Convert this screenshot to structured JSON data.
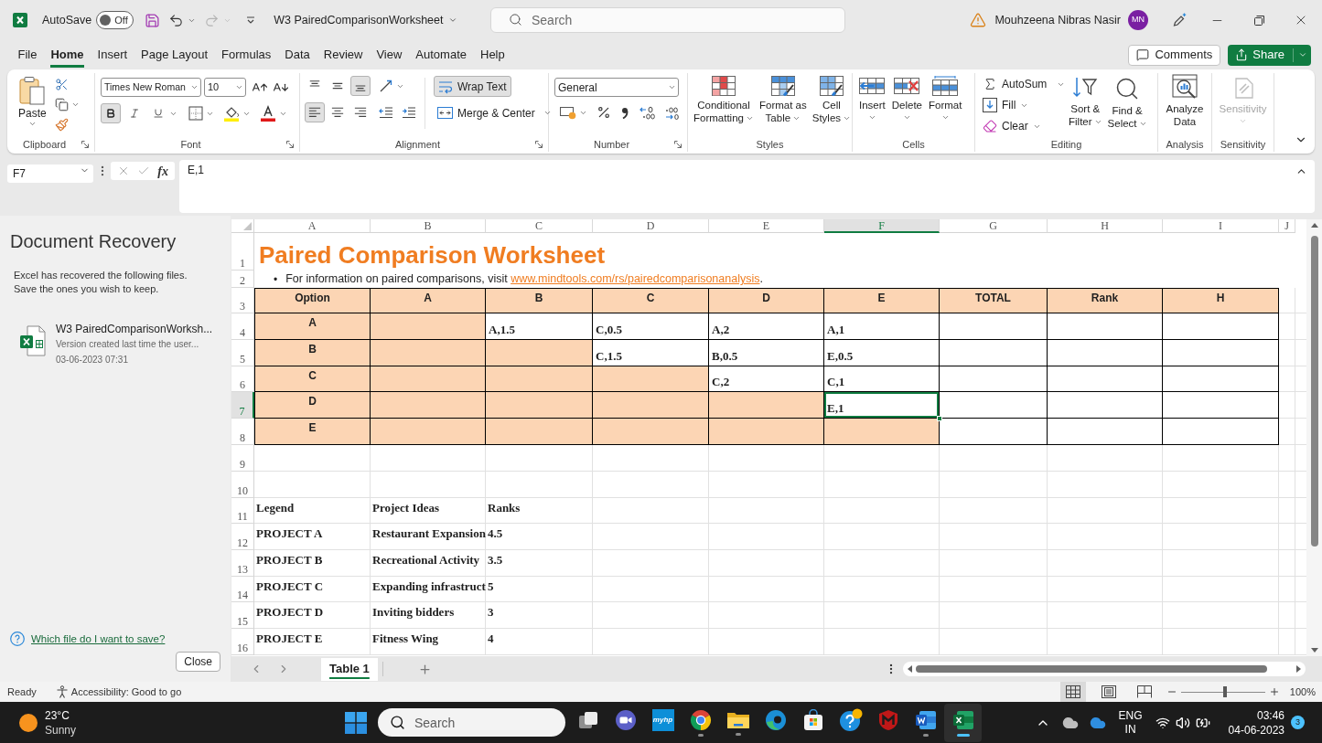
{
  "title_bar": {
    "autosave_label": "AutoSave",
    "autosave": {
      "on": false,
      "label": "Off"
    },
    "redo": {
      "disabled": true
    },
    "document_title": "W3 PairedComparisonWorksheet",
    "search_placeholder": "Search",
    "user_name": "Mouhzeena Nibras Nasir",
    "user_initials": "MN"
  },
  "menu_tabs": [
    {
      "label": "File",
      "selected": false
    },
    {
      "label": "Home",
      "selected": true
    },
    {
      "label": "Insert",
      "selected": false
    },
    {
      "label": "Page Layout",
      "selected": false
    },
    {
      "label": "Formulas",
      "selected": false
    },
    {
      "label": "Data",
      "selected": false
    },
    {
      "label": "Review",
      "selected": false
    },
    {
      "label": "View",
      "selected": false
    },
    {
      "label": "Automate",
      "selected": false
    },
    {
      "label": "Help",
      "selected": false
    }
  ],
  "comments_button": "Comments",
  "share_button": "Share",
  "ribbon": {
    "clipboard": {
      "paste": "Paste",
      "label": "Clipboard"
    },
    "font": {
      "font_name": "Times New Roman",
      "font_size": "10",
      "bold": true,
      "italic": false,
      "underline": false,
      "label": "Font"
    },
    "alignment": {
      "vertical": [
        {
          "kind": "top",
          "selected": false
        },
        {
          "kind": "middle",
          "selected": false
        },
        {
          "kind": "bottom",
          "selected": true
        }
      ],
      "horizontal": [
        {
          "kind": "left",
          "selected": true
        },
        {
          "kind": "center",
          "selected": false
        },
        {
          "kind": "right",
          "selected": false
        }
      ],
      "wrap_text": {
        "label": "Wrap Text",
        "on": true
      },
      "merge": "Merge & Center",
      "label": "Alignment"
    },
    "number": {
      "format": "General",
      "label": "Number"
    },
    "styles": {
      "buttons": [
        {
          "kind": "conditional_formatting",
          "lines": [
            "Conditional",
            "Formatting"
          ]
        },
        {
          "kind": "format_as_table",
          "lines": [
            "Format as",
            "Table"
          ]
        },
        {
          "kind": "cell_styles",
          "lines": [
            "Cell",
            "Styles"
          ]
        }
      ],
      "label": "Styles"
    },
    "cells": {
      "buttons": [
        {
          "kind": "insert",
          "label": "Insert"
        },
        {
          "kind": "delete",
          "label": "Delete"
        },
        {
          "kind": "format",
          "label": "Format"
        }
      ],
      "label": "Cells"
    },
    "editing": {
      "autosum": "AutoSum",
      "fill": "Fill",
      "clear": "Clear",
      "buttons": [
        {
          "kind": "sort_filter",
          "lines": [
            "Sort &",
            "Filter"
          ]
        },
        {
          "kind": "find_select",
          "lines": [
            "Find &",
            "Select"
          ]
        }
      ],
      "label": "Editing"
    },
    "analysis": {
      "lines": [
        "Analyze",
        "Data"
      ],
      "label": "Analysis"
    },
    "sensitivity": {
      "button": "Sensitivity",
      "disabled": true,
      "label": "Sensitivity"
    }
  },
  "formula_bar": {
    "name_box": "F7",
    "function_label": "fx",
    "formula": "E,1"
  },
  "document_recovery": {
    "title": "Document Recovery",
    "message_lines": [
      "Excel has recovered the following files.",
      "Save the ones you wish to keep."
    ],
    "files": [
      {
        "name": "W3 PairedComparisonWorksh...",
        "description": "Version created last time the user...",
        "date": "03-06-2023 07:31"
      }
    ],
    "help_link": "Which file do I want to save?",
    "close_button": "Close"
  },
  "sheet": {
    "column_headers": [
      {
        "label": "A",
        "selected": false
      },
      {
        "label": "B",
        "selected": false
      },
      {
        "label": "C",
        "selected": false
      },
      {
        "label": "D",
        "selected": false
      },
      {
        "label": "E",
        "selected": false
      },
      {
        "label": "F",
        "selected": true
      },
      {
        "label": "G",
        "selected": false
      },
      {
        "label": "H",
        "selected": false
      },
      {
        "label": "I",
        "selected": false
      },
      {
        "label": "J",
        "selected": false
      }
    ],
    "row_headers": [
      {
        "label": "1",
        "selected": false
      },
      {
        "label": "2",
        "selected": false
      },
      {
        "label": "3",
        "selected": false
      },
      {
        "label": "4",
        "selected": false
      },
      {
        "label": "5",
        "selected": false
      },
      {
        "label": "6",
        "selected": false
      },
      {
        "label": "7",
        "selected": true
      },
      {
        "label": "8",
        "selected": false
      },
      {
        "label": "9",
        "selected": false
      },
      {
        "label": "10",
        "selected": false
      },
      {
        "label": "11",
        "selected": false
      },
      {
        "label": "12",
        "selected": false
      },
      {
        "label": "13",
        "selected": false
      },
      {
        "label": "14",
        "selected": false
      },
      {
        "label": "15",
        "selected": false
      },
      {
        "label": "16",
        "selected": false
      }
    ],
    "title": "Paired Comparison Worksheet",
    "note": {
      "bullet": "•",
      "text": "For information on paired comparisons, visit",
      "link": "www.mindtools.com/rs/pairedcomparisonanalysis",
      "end": "."
    },
    "comparison_table": {
      "rows": [
        {
          "cells": [
            {
              "text": "Option",
              "shaded": true,
              "selected": false
            },
            {
              "text": "A",
              "shaded": true,
              "selected": false
            },
            {
              "text": "B",
              "shaded": true,
              "selected": false
            },
            {
              "text": "C",
              "shaded": true,
              "selected": false
            },
            {
              "text": "D",
              "shaded": true,
              "selected": false
            },
            {
              "text": "E",
              "shaded": true,
              "selected": false
            },
            {
              "text": "TOTAL",
              "shaded": true,
              "selected": false
            },
            {
              "text": "Rank",
              "shaded": true,
              "selected": false
            },
            {
              "text": "H",
              "shaded": true,
              "selected": false
            }
          ]
        },
        {
          "cells": [
            {
              "text": "A",
              "shaded": true,
              "selected": false
            },
            {
              "shaded": true,
              "selected": false
            },
            {
              "text": "A,1.5",
              "shaded": false,
              "selected": false
            },
            {
              "text": "C,0.5",
              "shaded": false,
              "selected": false
            },
            {
              "text": "A,2",
              "shaded": false,
              "selected": false
            },
            {
              "text": "A,1",
              "shaded": false,
              "selected": false
            },
            {
              "shaded": false,
              "selected": false
            },
            {
              "shaded": false,
              "selected": false
            },
            {
              "shaded": false,
              "selected": false
            }
          ]
        },
        {
          "cells": [
            {
              "text": "B",
              "shaded": true,
              "selected": false
            },
            {
              "shaded": true,
              "selected": false
            },
            {
              "shaded": true,
              "selected": false
            },
            {
              "text": "C,1.5",
              "shaded": false,
              "selected": false
            },
            {
              "text": "B,0.5",
              "shaded": false,
              "selected": false
            },
            {
              "text": "E,0.5",
              "shaded": false,
              "selected": false
            },
            {
              "shaded": false,
              "selected": false
            },
            {
              "shaded": false,
              "selected": false
            },
            {
              "shaded": false,
              "selected": false
            }
          ]
        },
        {
          "cells": [
            {
              "text": "C",
              "shaded": true,
              "selected": false
            },
            {
              "shaded": true,
              "selected": false
            },
            {
              "shaded": true,
              "selected": false
            },
            {
              "shaded": true,
              "selected": false
            },
            {
              "text": "C,2",
              "shaded": false,
              "selected": false
            },
            {
              "text": "C,1",
              "shaded": false,
              "selected": false
            },
            {
              "shaded": false,
              "selected": false
            },
            {
              "shaded": false,
              "selected": false
            },
            {
              "shaded": false,
              "selected": false
            }
          ]
        },
        {
          "cells": [
            {
              "text": "D",
              "shaded": true,
              "selected": false
            },
            {
              "shaded": true,
              "selected": false
            },
            {
              "shaded": true,
              "selected": false
            },
            {
              "shaded": true,
              "selected": false
            },
            {
              "shaded": true,
              "selected": false
            },
            {
              "text": "E,1",
              "shaded": false,
              "selected": true
            },
            {
              "shaded": false,
              "selected": false
            },
            {
              "shaded": false,
              "selected": false
            },
            {
              "shaded": false,
              "selected": false
            }
          ]
        },
        {
          "cells": [
            {
              "text": "E",
              "shaded": true,
              "selected": false
            },
            {
              "shaded": true,
              "selected": false
            },
            {
              "shaded": true,
              "selected": false
            },
            {
              "shaded": true,
              "selected": false
            },
            {
              "shaded": true,
              "selected": false
            },
            {
              "shaded": true,
              "selected": false
            },
            {
              "shaded": false,
              "selected": false
            },
            {
              "shaded": false,
              "selected": false
            },
            {
              "shaded": false,
              "selected": false
            }
          ]
        }
      ]
    },
    "legend_table": {
      "rows": [
        [
          "Legend",
          "Project Ideas",
          "Ranks"
        ],
        [
          "PROJECT A",
          "Restaurant Expansion",
          "4.5"
        ],
        [
          "PROJECT B",
          "Recreational Activity",
          "3.5"
        ],
        [
          "PROJECT C",
          "Expanding infrastruct",
          "5"
        ],
        [
          "PROJECT D",
          "Inviting bidders",
          "3"
        ],
        [
          "PROJECT E",
          "Fitness Wing",
          "4"
        ]
      ]
    }
  },
  "sheet_tabs": [
    {
      "label": "Table 1",
      "selected": true
    }
  ],
  "status_bar": {
    "status": "Ready",
    "accessibility": "Accessibility: Good to go",
    "views": [
      {
        "kind": "normal",
        "selected": true
      },
      {
        "kind": "page_layout",
        "selected": false
      },
      {
        "kind": "page_break",
        "selected": false
      }
    ],
    "zoom": {
      "level": 0.52,
      "label": "100%"
    }
  },
  "taskbar": {
    "weather": {
      "temperature": "23°C",
      "condition": "Sunny"
    },
    "search_placeholder": "Search",
    "apps": [
      {
        "kind": "task_view",
        "running": false,
        "selected": false
      },
      {
        "kind": "chat",
        "running": false,
        "selected": false
      },
      {
        "kind": "myhp",
        "label": "myhp",
        "running": false,
        "selected": false
      },
      {
        "kind": "chrome",
        "running": true,
        "selected": false
      },
      {
        "kind": "explorer",
        "running": true,
        "selected": false
      },
      {
        "kind": "edge",
        "running": false,
        "selected": false
      },
      {
        "kind": "store",
        "running": false,
        "selected": false
      },
      {
        "kind": "help",
        "running": false,
        "selected": false
      },
      {
        "kind": "mcafee",
        "running": false,
        "selected": false
      },
      {
        "kind": "word",
        "running": true,
        "selected": false
      },
      {
        "kind": "excel",
        "running": true,
        "selected": true
      }
    ],
    "language": [
      "ENG",
      "IN"
    ],
    "time": "03:46",
    "date": "04-06-2023",
    "notification_count": "3"
  }
}
